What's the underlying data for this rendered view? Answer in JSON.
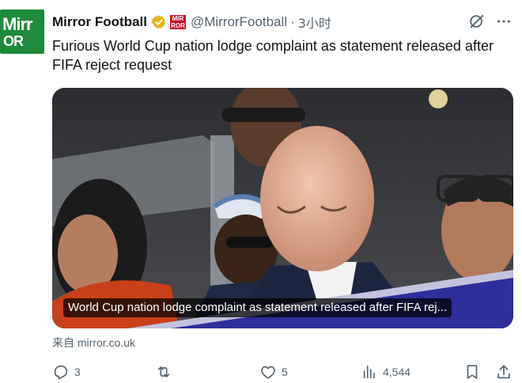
{
  "post": {
    "author_name": "Mirror Football",
    "handle": "@MirrorFootball",
    "separator": "·",
    "time": "3小时",
    "text": "Furious World Cup nation lodge complaint as statement released after FIFA reject request",
    "avatar_text_top": "Mirr",
    "avatar_text_bottom": "OR"
  },
  "card": {
    "caption": "World Cup nation lodge complaint as statement released after FIFA rej...",
    "source_prefix": "来自",
    "source_domain": "mirror.co.uk"
  },
  "actions": {
    "replies": "3",
    "reposts": "",
    "likes": "5",
    "views": "4,544"
  },
  "icons": {
    "verified": "verified-badge-icon",
    "affiliate": "affiliate-badge-icon",
    "grok": "grok-icon",
    "more": "more-icon",
    "reply": "reply-icon",
    "repost": "repost-icon",
    "like": "like-icon",
    "views": "views-icon",
    "bookmark": "bookmark-icon",
    "share": "share-icon"
  },
  "colors": {
    "text": "#0f1419",
    "secondary": "#536471",
    "verified_gold": "#e2b719",
    "brand_green": "#1f8a3c",
    "brand_red": "#c8102e"
  }
}
